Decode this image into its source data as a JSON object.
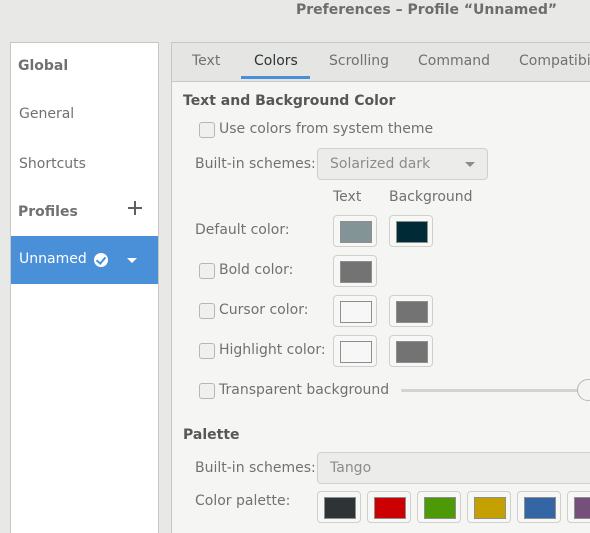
{
  "window": {
    "title": "Preferences – Profile “Unnamed”"
  },
  "sidebar": {
    "global_header": "Global",
    "items": [
      {
        "label": "General"
      },
      {
        "label": "Shortcuts"
      }
    ],
    "profiles_header": "Profiles",
    "selected_profile": "Unnamed"
  },
  "tabs": [
    "Text",
    "Colors",
    "Scrolling",
    "Command",
    "Compatibili"
  ],
  "active_tab": "Colors",
  "colors": {
    "section_title": "Text and Background Color",
    "use_system_theme": {
      "label": "Use colors from system theme",
      "checked": false
    },
    "builtin_schemes_label": "Built-in schemes:",
    "builtin_scheme_value": "Solarized dark",
    "col_text": "Text",
    "col_background": "Background",
    "default_color": {
      "label": "Default color:",
      "text": "#839496",
      "background": "#002b36"
    },
    "bold_color": {
      "label": "Bold color:",
      "checked": false,
      "text": "#737373"
    },
    "cursor_color": {
      "label": "Cursor color:",
      "checked": false,
      "text": "#f7f7f7",
      "background": "#737373"
    },
    "highlight_color": {
      "label": "Highlight color:",
      "checked": false,
      "text": "#f7f7f7",
      "background": "#737373"
    },
    "transparent_bg": {
      "label": "Transparent background",
      "checked": false,
      "level": 1.0
    }
  },
  "palette": {
    "section_title": "Palette",
    "builtin_schemes_label": "Built-in schemes:",
    "builtin_scheme_value": "Tango",
    "color_palette_label": "Color palette:",
    "swatches": [
      "#2e3436",
      "#cc0000",
      "#4e9a06",
      "#c4a000",
      "#3465a4",
      "#75507b"
    ]
  }
}
